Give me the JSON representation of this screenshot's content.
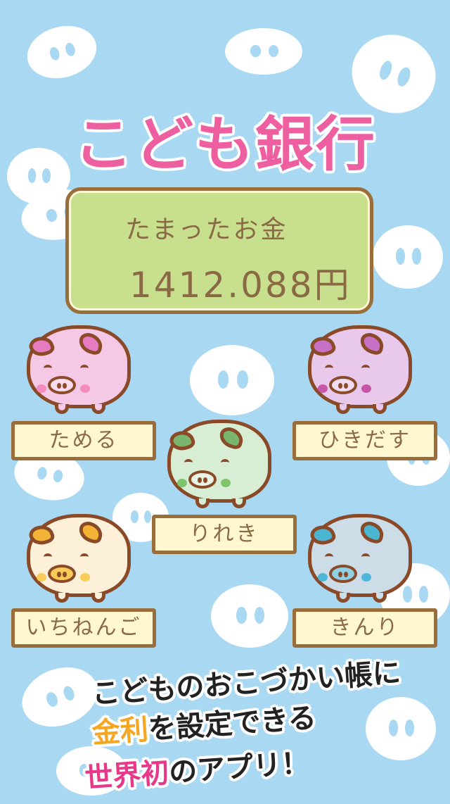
{
  "app": {
    "title": "こども銀行"
  },
  "savings": {
    "label": "たまったお金",
    "amount": "1412.088円"
  },
  "buttons": {
    "deposit": "ためる",
    "withdraw": "ひきだす",
    "history": "りれき",
    "annual": "いちねんご",
    "interest": "きんり"
  },
  "pigs": {
    "pink": {
      "body": "#f5c8e6",
      "accent": "#e57bc0",
      "cheek": "#f48bbf"
    },
    "purple": {
      "body": "#e8c9ec",
      "accent": "#c670c6",
      "cheek": "#c656a8"
    },
    "green": {
      "body": "#d7edd4",
      "accent": "#7ab56d",
      "cheek": "#7fc46d"
    },
    "cream": {
      "body": "#fdf0d8",
      "accent": "#f2b336",
      "cheek": "#f9cc5a"
    },
    "blue": {
      "body": "#ccdde8",
      "accent": "#4ab6d2",
      "cheek": "#4fb8d8"
    }
  },
  "promo": {
    "line1": "こどものおこづかい帳に",
    "line2_highlight": "金利",
    "line2_rest": "を設定できる",
    "line3_highlight": "世界初",
    "line3_rest": "のアプリ！"
  }
}
